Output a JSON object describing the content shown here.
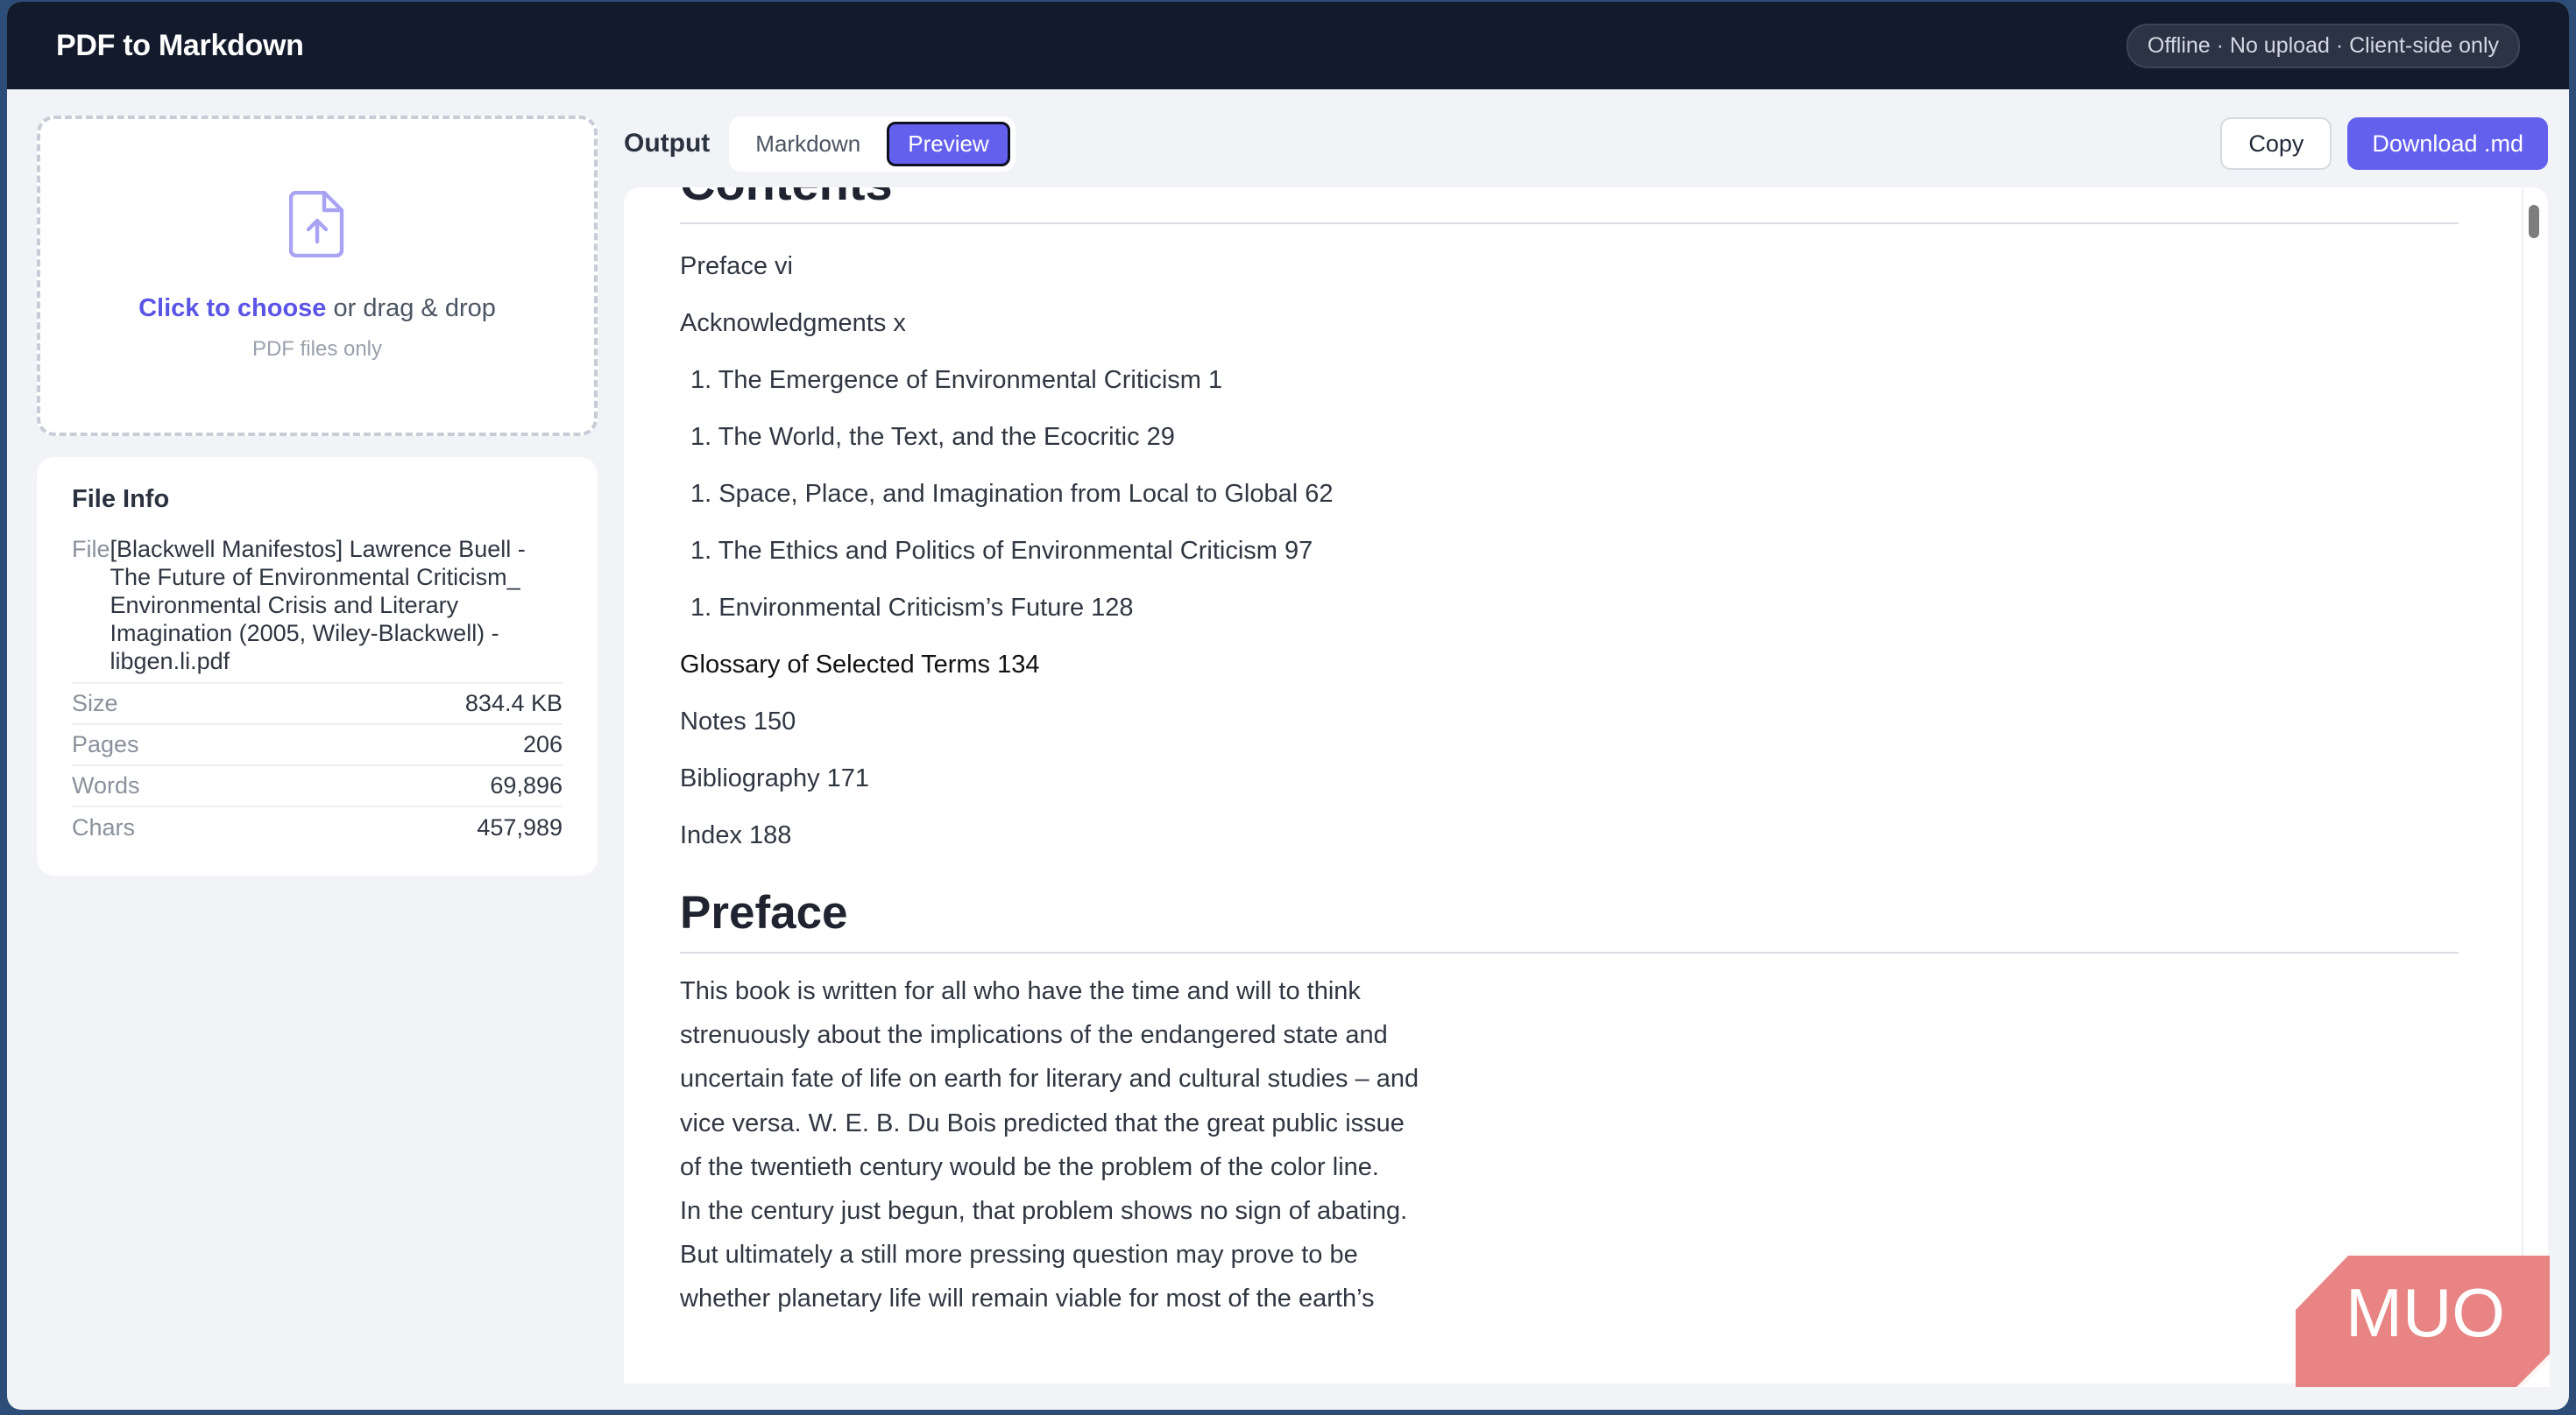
{
  "app": {
    "title": "PDF to Markdown",
    "status": "Offline · No upload · Client-side only"
  },
  "upload": {
    "link_text": "Click to choose",
    "rest_text": " or drag & drop",
    "hint": "PDF files only",
    "icon": "file-upload-icon"
  },
  "file_info": {
    "heading": "File Info",
    "file_label": "File",
    "file_name": "[Blackwell Manifestos] Lawrence Buell - The Future of Environmental Criticism_ Environmental Crisis and Literary Imagination (2005, Wiley-Blackwell) - libgen.li.pdf",
    "rows": [
      {
        "label": "Size",
        "value": "834.4 KB"
      },
      {
        "label": "Pages",
        "value": "206"
      },
      {
        "label": "Words",
        "value": "69,896"
      },
      {
        "label": "Chars",
        "value": "457,989"
      }
    ]
  },
  "toolbar": {
    "output_label": "Output",
    "tabs": [
      {
        "label": "Markdown",
        "active": false
      },
      {
        "label": "Preview",
        "active": true
      }
    ],
    "copy_label": "Copy",
    "download_label": "Download .md"
  },
  "preview": {
    "contents_heading": "Contents",
    "toc": [
      "Preface vi",
      "Acknowledgments x",
      "1. The Emergence of Environmental Criticism 1",
      "1. The World, the Text, and the Ecocritic 29",
      "1. Space, Place, and Imagination from Local to Global 62",
      "1. The Ethics and Politics of Environmental Criticism 97",
      "1. Environmental Criticism’s Future 128",
      "Glossary of Selected Terms 134",
      "Notes 150",
      "Bibliography 171",
      "Index 188"
    ],
    "preface_heading": "Preface",
    "preface_lines": [
      "This book is written for all who have the time and will to think",
      "strenuously about the implications of the endangered state and",
      "uncertain fate of life on earth for literary and cultural studies – and",
      "vice versa. W. E. B. Du Bois predicted that the great public issue",
      "of the twentieth century would be the problem of the color line.",
      "In the century just begun, that problem shows no sign of abating.",
      "But ultimately a still more pressing question may prove to be",
      "whether planetary life will remain viable for most of the earth’s"
    ]
  },
  "watermark": {
    "text": "MUO"
  },
  "colors": {
    "accent": "#6460ee",
    "header_bg": "#121a2c",
    "frame_bg": "#2c4d78",
    "watermark": "#e57373"
  }
}
